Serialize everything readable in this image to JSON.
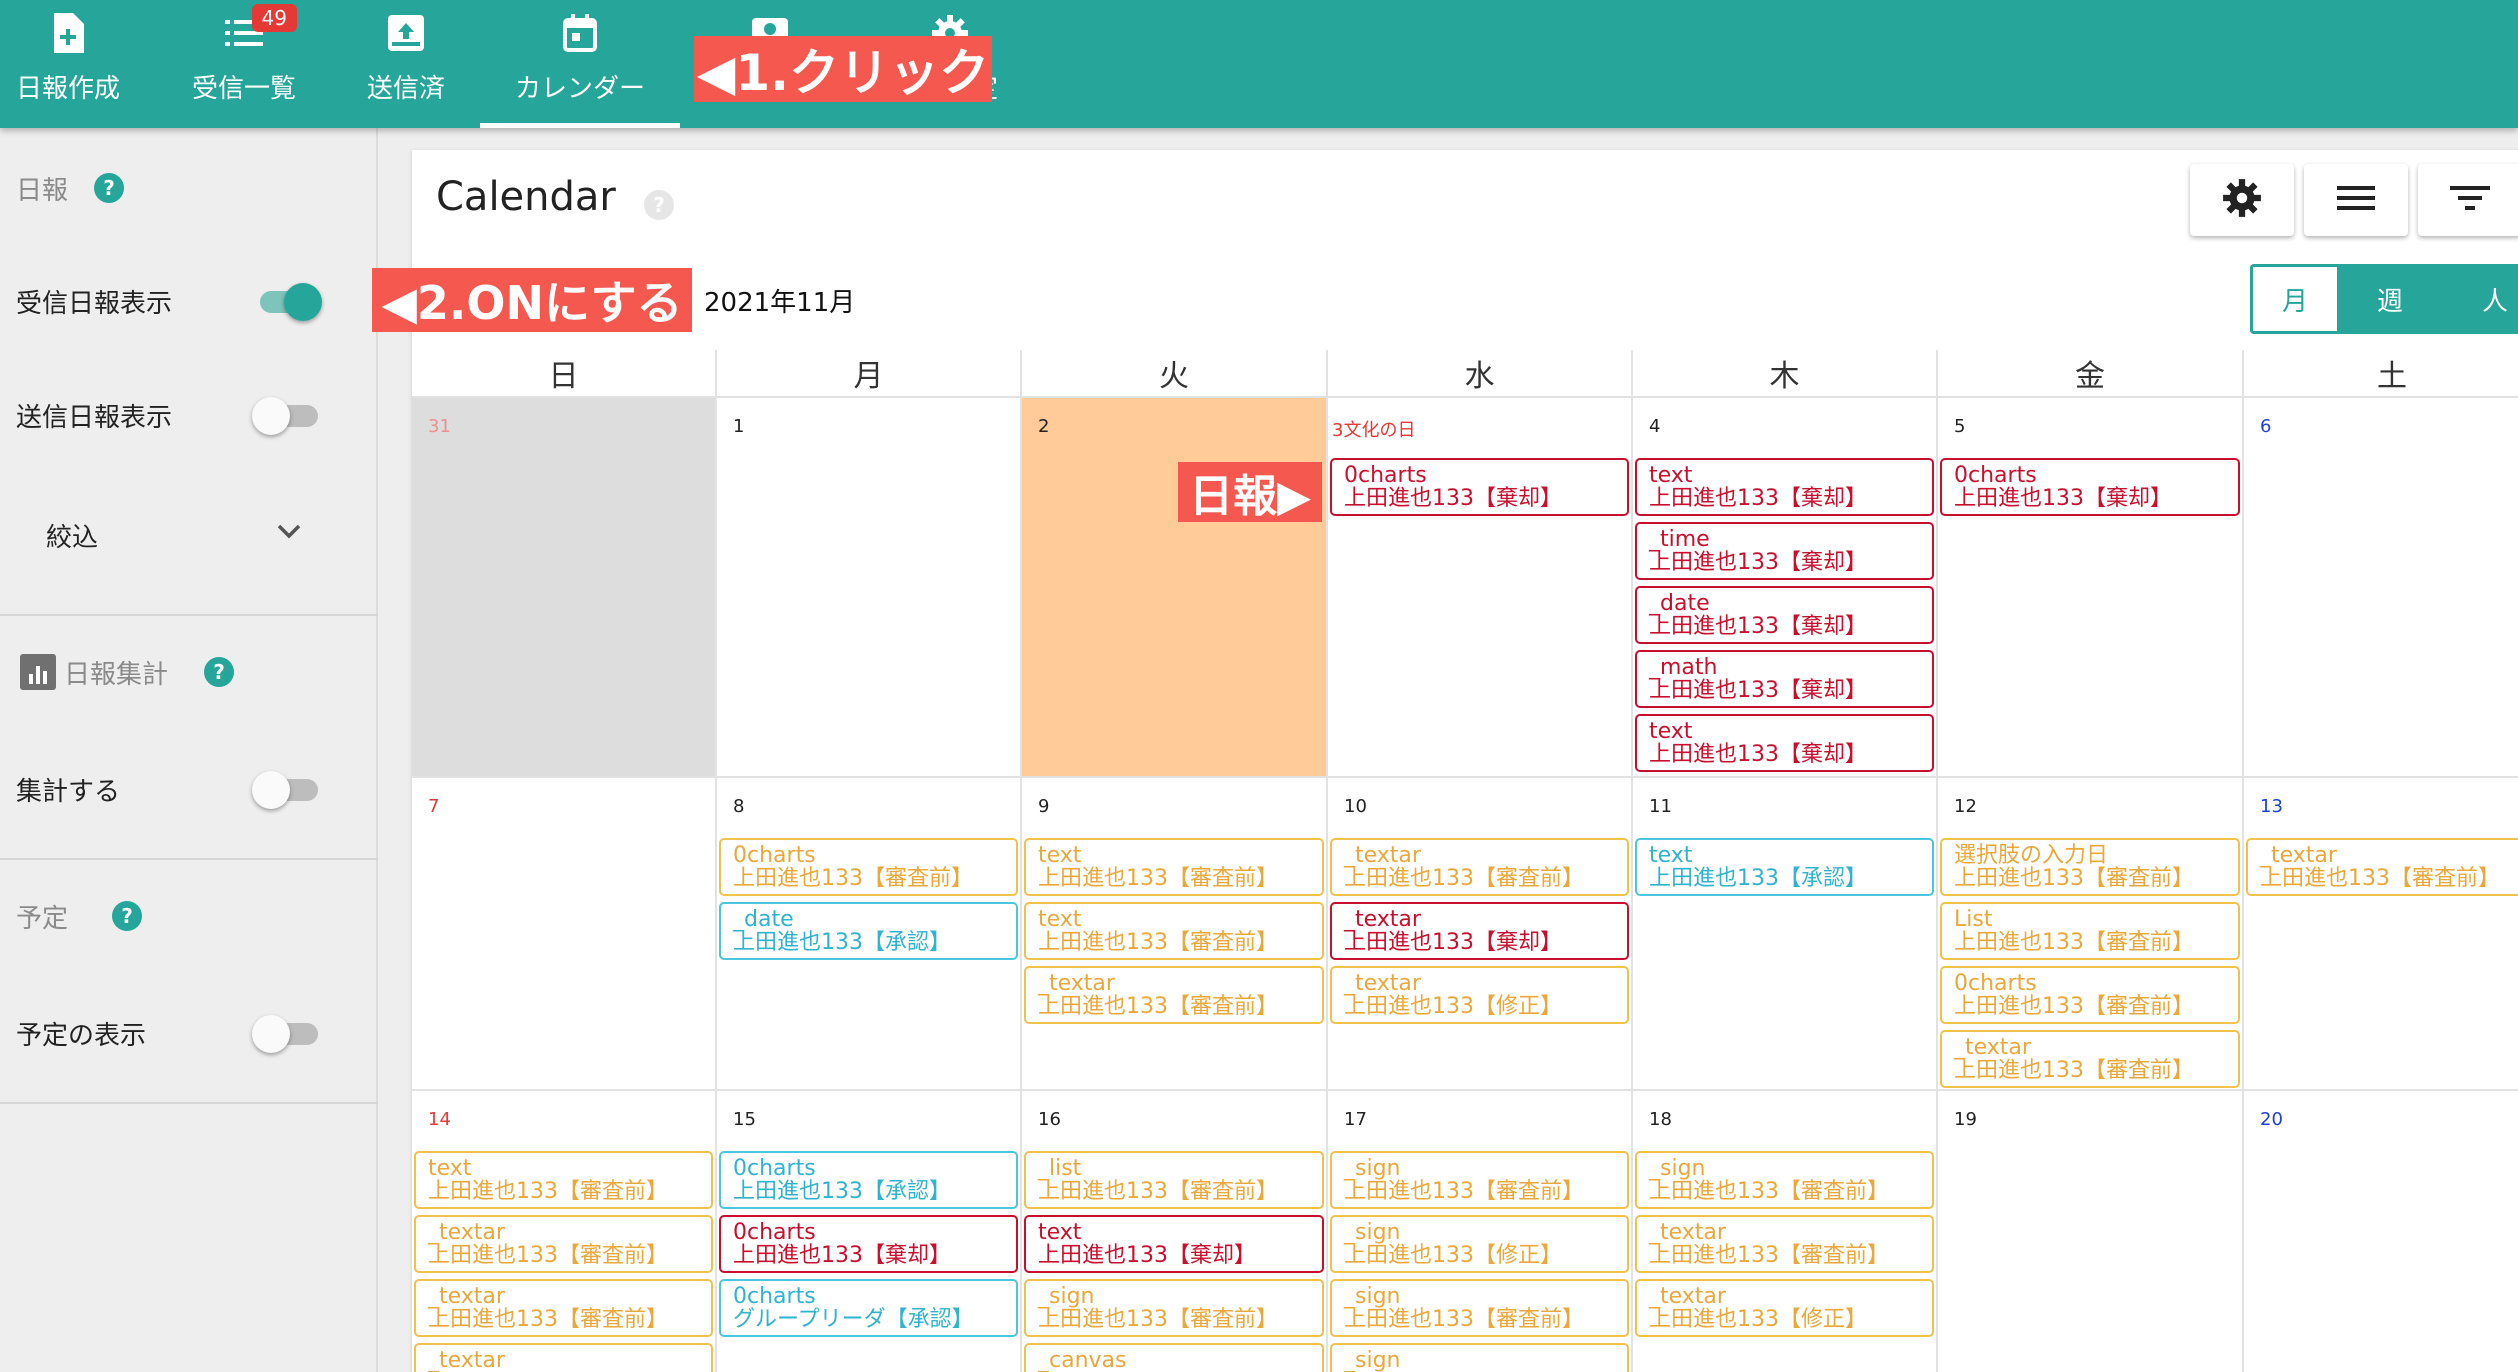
{
  "nav": {
    "items": [
      {
        "label": "日報作成",
        "icon": "note-add-icon"
      },
      {
        "label": "受信一覧",
        "icon": "list-icon",
        "badge": "49"
      },
      {
        "label": "送信済",
        "icon": "outbox-icon"
      },
      {
        "label": "カレンダー",
        "icon": "calendar-icon",
        "active": true
      },
      {
        "label": "",
        "icon": "account-box-icon"
      },
      {
        "label": "定",
        "icon": "gear-icon"
      }
    ],
    "annotation_click": "◀1.クリック"
  },
  "sidebar": {
    "report_header": "日報",
    "received_label": "受信日報表示",
    "received_on": true,
    "sent_label": "送信日報表示",
    "sent_on": false,
    "filter_label": "絞込",
    "summary_header": "日報集計",
    "summary_label": "集計する",
    "summary_on": false,
    "schedule_header": "予定",
    "schedule_label": "予定の表示",
    "schedule_on": false,
    "annotation_on": "◀2.ONにする"
  },
  "calendar": {
    "title": "Calendar",
    "help": "?",
    "month": "2021年11月",
    "views": [
      "月",
      "週",
      "人"
    ],
    "active_view": "月",
    "weekdays": [
      "日",
      "月",
      "火",
      "水",
      "木",
      "金",
      "土"
    ],
    "annotation_report": "日報▶",
    "weeks": [
      [
        {
          "day": "31",
          "kind": "faded",
          "other": true,
          "events": []
        },
        {
          "day": "1",
          "events": []
        },
        {
          "day": "2",
          "today": true,
          "events": []
        },
        {
          "day": "3文化の日",
          "kind": "holiday",
          "events": [
            {
              "t": "0charts",
              "a": "上田進也133【棄却】",
              "s": "rej"
            }
          ]
        },
        {
          "day": "4",
          "events": [
            {
              "t": "text",
              "a": "上田進也133【棄却】",
              "s": "rej"
            },
            {
              "t": "_time",
              "a": "上田進也133【棄却】",
              "s": "rej"
            },
            {
              "t": "_date",
              "a": "上田進也133【棄却】",
              "s": "rej"
            },
            {
              "t": "_math",
              "a": "上田進也133【棄却】",
              "s": "rej"
            },
            {
              "t": "text",
              "a": "上田進也133【棄却】",
              "s": "rej"
            }
          ]
        },
        {
          "day": "5",
          "events": [
            {
              "t": "0charts",
              "a": "上田進也133【棄却】",
              "s": "rej"
            }
          ]
        },
        {
          "day": "6",
          "kind": "sat",
          "events": []
        }
      ],
      [
        {
          "day": "7",
          "kind": "sun",
          "events": []
        },
        {
          "day": "8",
          "events": [
            {
              "t": "0charts",
              "a": "上田進也133【審査前】",
              "s": "pend"
            },
            {
              "t": "_date",
              "a": "上田進也133【承認】",
              "s": "ok"
            }
          ]
        },
        {
          "day": "9",
          "events": [
            {
              "t": "text",
              "a": "上田進也133【審査前】",
              "s": "pend"
            },
            {
              "t": "text",
              "a": "上田進也133【審査前】",
              "s": "pend"
            },
            {
              "t": "_textar",
              "a": "上田進也133【審査前】",
              "s": "pend"
            }
          ]
        },
        {
          "day": "10",
          "events": [
            {
              "t": "_textar",
              "a": "上田進也133【審査前】",
              "s": "pend"
            },
            {
              "t": "_textar",
              "a": "上田進也133【棄却】",
              "s": "rej"
            },
            {
              "t": "_textar",
              "a": "上田進也133【修正】",
              "s": "pend"
            }
          ]
        },
        {
          "day": "11",
          "events": [
            {
              "t": "text",
              "a": "上田進也133【承認】",
              "s": "ok"
            }
          ]
        },
        {
          "day": "12",
          "events": [
            {
              "t": "選択肢の入力日",
              "a": "上田進也133【審査前】",
              "s": "pend"
            },
            {
              "t": "List",
              "a": "上田進也133【審査前】",
              "s": "pend"
            },
            {
              "t": "0charts",
              "a": "上田進也133【審査前】",
              "s": "pend"
            },
            {
              "t": "_textar",
              "a": "上田進也133【審査前】",
              "s": "pend"
            }
          ]
        },
        {
          "day": "13",
          "kind": "sat",
          "events": [
            {
              "t": "_textar",
              "a": "上田進也133【審査前】",
              "s": "pend"
            }
          ]
        }
      ],
      [
        {
          "day": "14",
          "kind": "sun",
          "events": [
            {
              "t": "text",
              "a": "上田進也133【審査前】",
              "s": "pend"
            },
            {
              "t": "_textar",
              "a": "上田進也133【審査前】",
              "s": "pend"
            },
            {
              "t": "_textar",
              "a": "上田進也133【審査前】",
              "s": "pend"
            },
            {
              "t": "_textar",
              "a": "",
              "s": "pend"
            }
          ]
        },
        {
          "day": "15",
          "events": [
            {
              "t": "0charts",
              "a": "上田進也133【承認】",
              "s": "ok"
            },
            {
              "t": "0charts",
              "a": "上田進也133【棄却】",
              "s": "rej"
            },
            {
              "t": "0charts",
              "a": "グループリーダ【承認】",
              "s": "ok"
            }
          ]
        },
        {
          "day": "16",
          "events": [
            {
              "t": "_list",
              "a": "上田進也133【審査前】",
              "s": "pend"
            },
            {
              "t": "text",
              "a": "上田進也133【棄却】",
              "s": "rej"
            },
            {
              "t": "_sign",
              "a": "上田進也133【審査前】",
              "s": "pend"
            },
            {
              "t": "_canvas",
              "a": "",
              "s": "pend"
            }
          ]
        },
        {
          "day": "17",
          "events": [
            {
              "t": "_sign",
              "a": "上田進也133【審査前】",
              "s": "pend"
            },
            {
              "t": "_sign",
              "a": "上田進也133【修正】",
              "s": "pend"
            },
            {
              "t": "_sign",
              "a": "上田進也133【審査前】",
              "s": "pend"
            },
            {
              "t": "_sign",
              "a": "",
              "s": "pend"
            }
          ]
        },
        {
          "day": "18",
          "events": [
            {
              "t": "_sign",
              "a": "上田進也133【審査前】",
              "s": "pend"
            },
            {
              "t": "_textar",
              "a": "上田進也133【審査前】",
              "s": "pend"
            },
            {
              "t": "_textar",
              "a": "上田進也133【修正】",
              "s": "pend"
            }
          ]
        },
        {
          "day": "19",
          "events": []
        },
        {
          "day": "20",
          "kind": "sat",
          "events": []
        }
      ]
    ]
  }
}
